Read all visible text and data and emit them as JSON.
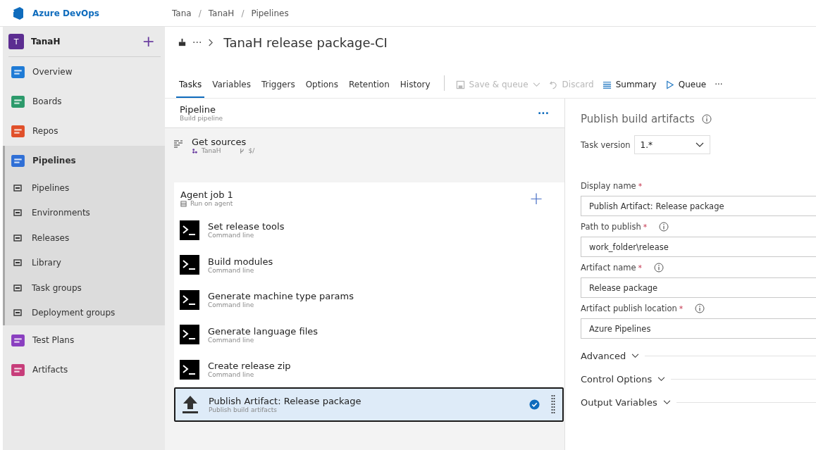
{
  "brand": "Azure DevOps",
  "breadcrumb": [
    {
      "label": "Tana"
    },
    {
      "separator": "/",
      "label": "TanaH"
    },
    {
      "separator": "/",
      "label": "Pipelines"
    }
  ],
  "sidebar": {
    "project": {
      "initial": "T",
      "name": "TanaH",
      "add": "+"
    },
    "items": [
      {
        "label": "Overview",
        "kind": "overview",
        "selected": false
      },
      {
        "label": "Boards",
        "kind": "boards",
        "selected": false
      },
      {
        "label": "Repos",
        "kind": "repos",
        "selected": false
      },
      {
        "label": "Pipelines",
        "kind": "pipelines",
        "selected": true,
        "expanded": true,
        "children": [
          {
            "label": "Pipelines"
          },
          {
            "label": "Environments"
          },
          {
            "label": "Releases"
          },
          {
            "label": "Library"
          },
          {
            "label": "Task groups"
          },
          {
            "label": "Deployment groups"
          }
        ]
      },
      {
        "label": "Test Plans",
        "kind": "testplans",
        "selected": false
      },
      {
        "label": "Artifacts",
        "kind": "artifacts",
        "selected": false
      }
    ]
  },
  "header": {
    "ellipsis": "···",
    "title": "TanaH release package-CI"
  },
  "tabs": [
    {
      "label": "Tasks",
      "selected": true
    },
    {
      "label": "Variables",
      "selected": false
    },
    {
      "label": "Triggers",
      "selected": false
    },
    {
      "label": "Options",
      "selected": false
    },
    {
      "label": "Retention",
      "selected": false
    },
    {
      "label": "History",
      "selected": false
    }
  ],
  "toolbar": [
    {
      "label": "Save & queue",
      "kind": "save",
      "disabled": true
    },
    {
      "label": "Discard",
      "kind": "discard",
      "disabled": true
    },
    {
      "label": "Summary",
      "kind": "summary",
      "disabled": false
    },
    {
      "label": "Queue",
      "kind": "queue",
      "disabled": false
    }
  ],
  "toolbar_more": "···",
  "pipeline": {
    "title": "Pipeline",
    "subtitle": "Build pipeline",
    "more": "···"
  },
  "sources": {
    "title": "Get sources",
    "repo": "TanaH",
    "path": "$/"
  },
  "job": {
    "title": "Agent job 1",
    "subtitle": "Run on agent",
    "add": "+"
  },
  "tasks": [
    {
      "title": "Set release tools",
      "subtitle": "Command line",
      "kind": "command",
      "selected": false
    },
    {
      "title": "Build modules",
      "subtitle": "Command line",
      "kind": "command",
      "selected": false
    },
    {
      "title": "Generate machine type params",
      "subtitle": "Command line",
      "kind": "command",
      "selected": false
    },
    {
      "title": "Generate language files",
      "subtitle": "Command line",
      "kind": "command",
      "selected": false
    },
    {
      "title": "Create release zip",
      "subtitle": "Command line",
      "kind": "command",
      "selected": false
    },
    {
      "title": "Publish Artifact: Release package",
      "subtitle": "Publish build artifacts",
      "kind": "publish",
      "selected": true
    }
  ],
  "details": {
    "title": "Publish build artifacts",
    "version_label": "Task version",
    "version": "1.*",
    "fields": [
      {
        "label": "Display name",
        "required_mark": "*",
        "info": false,
        "value": "Publish Artifact: Release package"
      },
      {
        "label": "Path to publish",
        "required_mark": "*",
        "info": true,
        "value": "work_folder\\release"
      },
      {
        "label": "Artifact name",
        "required_mark": "*",
        "info": true,
        "value": "Release package"
      },
      {
        "label": "Artifact publish location",
        "required_mark": "*",
        "info": true,
        "value": "Azure Pipelines"
      }
    ],
    "sections": [
      {
        "label": "Advanced",
        "expanded": false
      },
      {
        "label": "Control Options",
        "expanded": false
      },
      {
        "label": "Output Variables",
        "expanded": false
      }
    ]
  }
}
